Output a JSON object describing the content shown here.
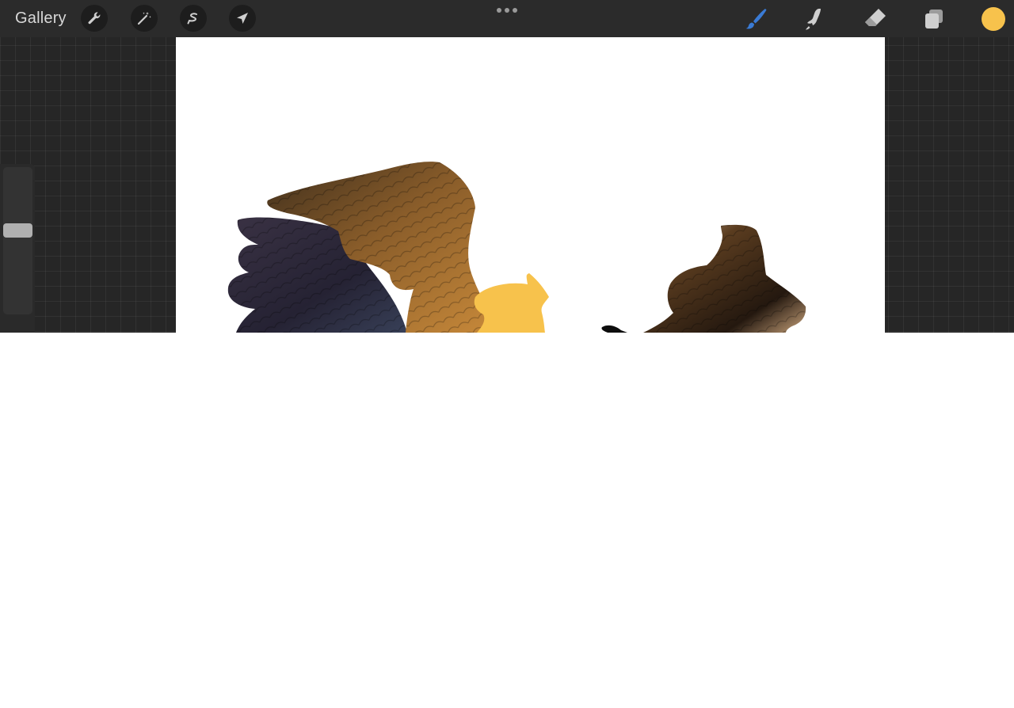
{
  "toolbar": {
    "gallery_label": "Gallery",
    "left_tools": [
      "wrench-icon",
      "magic-wand-icon",
      "selection-icon",
      "transform-arrow-icon"
    ],
    "more_menu": "ellipsis-icon",
    "right_tools": [
      "brush-icon",
      "smudge-icon",
      "eraser-icon",
      "layers-icon"
    ],
    "active_tool": "brush",
    "current_color": "#f7c24c"
  },
  "colors": {
    "accent": "#3a7bd5",
    "toolbar_bg": "#2b2b2b",
    "workspace_bg": "#262626",
    "canvas_bg": "#ffffff"
  },
  "sidebar": {
    "size_slider": "vertical-size-slider",
    "slider_value": 0.42
  }
}
